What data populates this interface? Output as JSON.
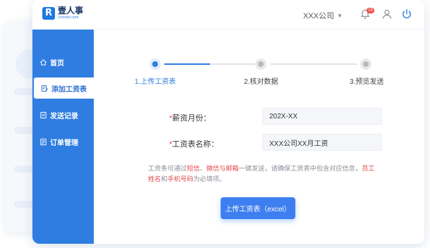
{
  "app": {
    "logo_letter": "R",
    "logo_name": "壹人事",
    "logo_url": "1renshi.com"
  },
  "header": {
    "company": "XXX公司",
    "notification_count": "18"
  },
  "sidebar": {
    "items": [
      {
        "label": "首页",
        "icon": "home-icon"
      },
      {
        "label": "添加工资表",
        "icon": "edit-sheet-icon",
        "active": true
      },
      {
        "label": "发送记录",
        "icon": "document-icon"
      },
      {
        "label": "订单管理",
        "icon": "order-icon"
      }
    ]
  },
  "steps": [
    {
      "label": "1.上传工资表",
      "active": true
    },
    {
      "label": "2.核对数据",
      "active": false
    },
    {
      "label": "3.预览发送",
      "active": false
    }
  ],
  "progress": {
    "first_segment_filled_fraction": 0.5
  },
  "form": {
    "month": {
      "required_mark": "*",
      "label": "薪资月份：",
      "value": "202X-XX"
    },
    "name": {
      "required_mark": "*",
      "label": "工资表名称：",
      "value": "XXX公司XX月工资"
    }
  },
  "tip": {
    "t1": "工资条可通过",
    "h1": "短信",
    "t2": "、",
    "h2": "微信与邮箱",
    "t3": "一键发送，请确保工资表中包含对应信息，",
    "h3": "员工姓名",
    "t4": "和",
    "h4": "手机号码",
    "t5": "为必填项。"
  },
  "upload_button": "上传工资表（excel）",
  "colors": {
    "primary": "#2f7de1",
    "highlight": "#e5484d",
    "badge": "#f04848"
  }
}
